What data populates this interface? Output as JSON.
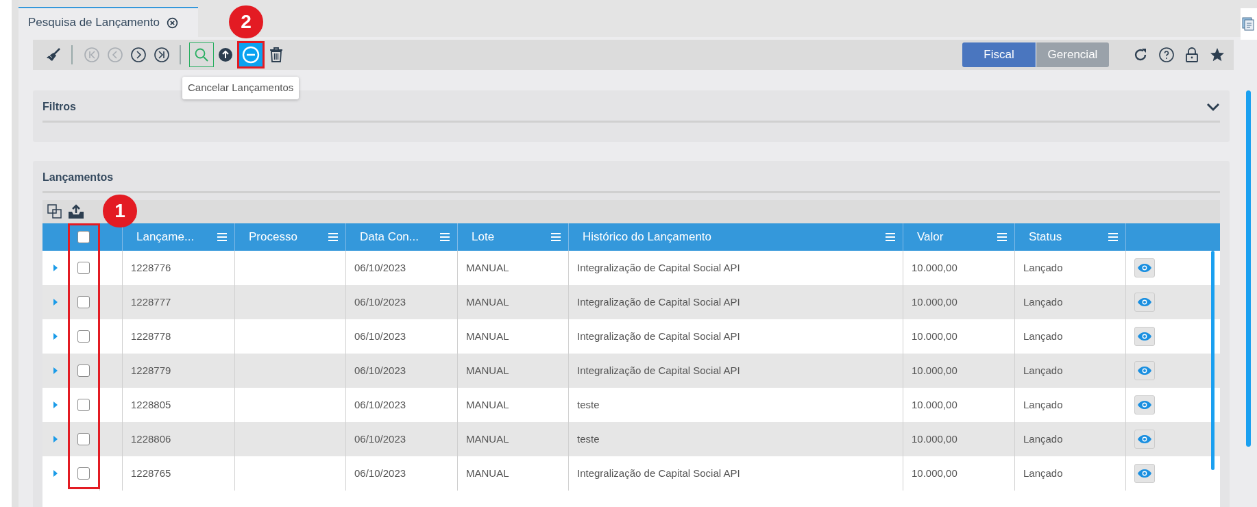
{
  "tab": {
    "title": "Pesquisa de Lançamento"
  },
  "toolbar": {
    "nav": [
      {
        "kind": "first",
        "disabled": true
      },
      {
        "kind": "prev",
        "disabled": true
      },
      {
        "kind": "next",
        "disabled": false
      },
      {
        "kind": "last",
        "disabled": false
      }
    ],
    "search_selected": true,
    "tooltip": "Cancelar Lançamentos",
    "view_toggle": [
      {
        "label": "Fiscal",
        "selected": true
      },
      {
        "label": "Gerencial",
        "selected": false
      }
    ]
  },
  "annotations": [
    {
      "label": "1"
    },
    {
      "label": "2"
    }
  ],
  "filters": {
    "title": "Filtros",
    "expanded": false
  },
  "entries": {
    "title": "Lançamentos",
    "all_checked": false,
    "columns": [
      "Lançame...",
      "Processo",
      "Data Con...",
      "Lote",
      "Histórico do Lançamento",
      "Valor",
      "Status"
    ],
    "rows": [
      {
        "id": "1228776",
        "process": "",
        "date": "06/10/2023",
        "batch": "MANUAL",
        "history": "Integralização de Capital Social API",
        "value": "10.000,00",
        "status": "Lançado",
        "checked": false
      },
      {
        "id": "1228777",
        "process": "",
        "date": "06/10/2023",
        "batch": "MANUAL",
        "history": "Integralização de Capital Social API",
        "value": "10.000,00",
        "status": "Lançado",
        "checked": false
      },
      {
        "id": "1228778",
        "process": "",
        "date": "06/10/2023",
        "batch": "MANUAL",
        "history": "Integralização de Capital Social API",
        "value": "10.000,00",
        "status": "Lançado",
        "checked": false
      },
      {
        "id": "1228779",
        "process": "",
        "date": "06/10/2023",
        "batch": "MANUAL",
        "history": "Integralização de Capital Social API",
        "value": "10.000,00",
        "status": "Lançado",
        "checked": false
      },
      {
        "id": "1228805",
        "process": "",
        "date": "06/10/2023",
        "batch": "MANUAL",
        "history": "teste",
        "value": "10.000,00",
        "status": "Lançado",
        "checked": false
      },
      {
        "id": "1228806",
        "process": "",
        "date": "06/10/2023",
        "batch": "MANUAL",
        "history": "teste",
        "value": "10.000,00",
        "status": "Lançado",
        "checked": false
      },
      {
        "id": "1228765",
        "process": "",
        "date": "06/10/2023",
        "batch": "MANUAL",
        "history": "Integralização de Capital Social API",
        "value": "10.000,00",
        "status": "Lançado",
        "checked": false
      }
    ]
  }
}
